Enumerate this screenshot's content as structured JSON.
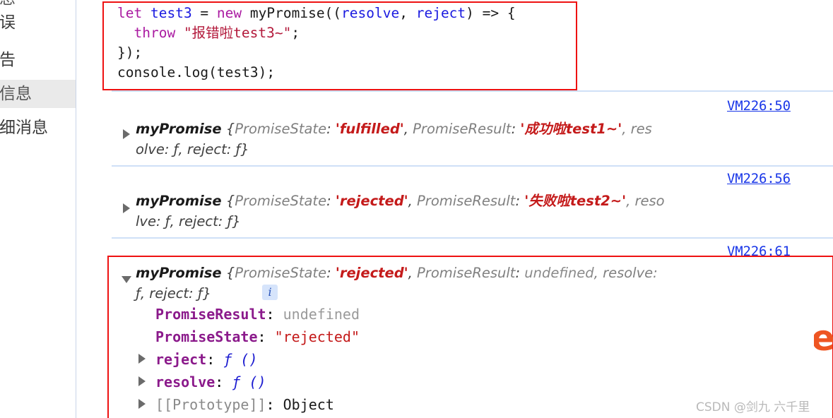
{
  "sidebar": {
    "items": [
      {
        "label": "信息",
        "state": "clipped"
      },
      {
        "label": "错误",
        "state": "normal"
      },
      {
        "label": "警告",
        "state": "normal"
      },
      {
        "label": "条信息",
        "state": "selected"
      },
      {
        "label": "详细消息",
        "state": "normal"
      }
    ]
  },
  "code_block": {
    "lines": [
      {
        "tokens": [
          {
            "t": "let",
            "c": "kw"
          },
          {
            "t": " ",
            "c": "plain"
          },
          {
            "t": "test3",
            "c": "ident"
          },
          {
            "t": " = ",
            "c": "plain"
          },
          {
            "t": "new",
            "c": "kw"
          },
          {
            "t": " myPromise((",
            "c": "plain"
          },
          {
            "t": "resolve",
            "c": "ident"
          },
          {
            "t": ", ",
            "c": "plain"
          },
          {
            "t": "reject",
            "c": "ident"
          },
          {
            "t": ") => {",
            "c": "plain"
          }
        ]
      },
      {
        "tokens": [
          {
            "t": "  ",
            "c": "plain"
          },
          {
            "t": "throw",
            "c": "kw"
          },
          {
            "t": " ",
            "c": "plain"
          },
          {
            "t": "\"报错啦test3~\"",
            "c": "str"
          },
          {
            "t": ";",
            "c": "plain"
          }
        ]
      },
      {
        "tokens": [
          {
            "t": "});",
            "c": "plain"
          }
        ]
      },
      {
        "tokens": [
          {
            "t": "console.log(test3);",
            "c": "plain"
          }
        ]
      }
    ]
  },
  "console_entries": [
    {
      "vm_link": "VM226:50",
      "expanded": false,
      "line1": {
        "obj": "myPromise",
        "open": " {",
        "key1": "PromiseState",
        "sep1": ": ",
        "val1": "'fulfilled'",
        "comma1": ", ",
        "key2": "PromiseResult",
        "sep2": ": ",
        "val2": "'成功啦test1~'",
        "tail": ", res"
      },
      "line2": "olve: ƒ, reject: ƒ}"
    },
    {
      "vm_link": "VM226:56",
      "expanded": false,
      "line1": {
        "obj": "myPromise",
        "open": " {",
        "key1": "PromiseState",
        "sep1": ": ",
        "val1": "'rejected'",
        "comma1": ", ",
        "key2": "PromiseResult",
        "sep2": ": ",
        "val2": "'失败啦test2~'",
        "tail": ", reso"
      },
      "line2": "lve: ƒ, reject: ƒ}"
    },
    {
      "vm_link": "VM226:61",
      "expanded": true,
      "line1": {
        "obj": "myPromise",
        "open": " {",
        "key1": "PromiseState",
        "sep1": ": ",
        "val1": "'rejected'",
        "comma1": ", ",
        "key2": "PromiseResult",
        "sep2": ": ",
        "val2": "undefined",
        "tail": ", resolve:"
      },
      "line2": "ƒ, reject: ƒ}",
      "info_badge": "i",
      "properties": [
        {
          "key": "PromiseResult",
          "sep": ": ",
          "value": "undefined",
          "value_kind": "undef",
          "has_arrow": false
        },
        {
          "key": "PromiseState",
          "sep": ": ",
          "value": "\"rejected\"",
          "value_kind": "str",
          "has_arrow": false
        },
        {
          "key": "reject",
          "sep": ": ",
          "value": "ƒ ()",
          "value_kind": "fn",
          "has_arrow": true
        },
        {
          "key": "resolve",
          "sep": ": ",
          "value": "ƒ ()",
          "value_kind": "fn",
          "has_arrow": true
        },
        {
          "key": "[[Prototype]]",
          "sep": ": ",
          "value": "Object",
          "value_kind": "obj",
          "has_arrow": true
        }
      ]
    }
  ],
  "watermark": "CSDN @剑九 六千里",
  "edge_logo": {
    "glyph": "e"
  },
  "colors": {
    "highlight_red": "#ee1111",
    "link_blue": "#1a37e8",
    "divider_blue": "#cfe0f7",
    "string_red": "#c41a1a",
    "keyword_purple": "#aa1aa1",
    "identifier_blue": "#1a1ae0",
    "property_purple": "#8b1a8b",
    "selected_row_gray": "#eaeaea"
  }
}
